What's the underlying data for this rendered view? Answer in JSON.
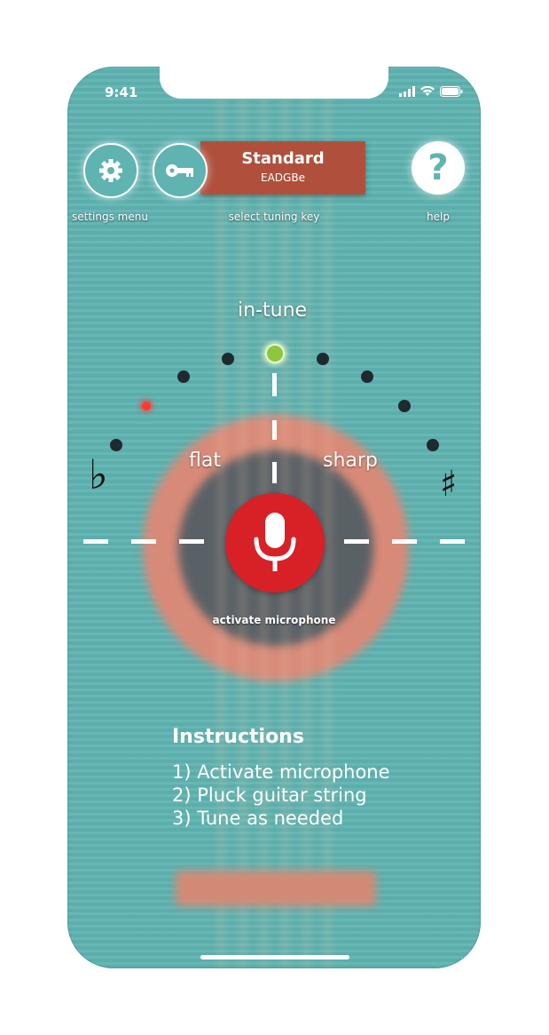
{
  "status_bar": {
    "time": "9:41"
  },
  "header": {
    "settings": {
      "label": "settings menu",
      "icon": "gear-icon"
    },
    "tuning": {
      "name": "Standard",
      "notes": "EADGBe",
      "label": "select tuning key",
      "icon": "key-icon"
    },
    "help": {
      "label": "help",
      "glyph": "?"
    }
  },
  "meter": {
    "in_tune_label": "in-tune",
    "flat_label": "flat",
    "sharp_label": "sharp",
    "flat_symbol": "♭",
    "sharp_symbol": "♯",
    "active_indicator": "in-tune"
  },
  "microphone": {
    "label": "activate microphone",
    "icon": "microphone-icon"
  },
  "instructions": {
    "title": "Instructions",
    "steps": [
      "1) Activate microphone",
      "2) Pluck guitar string",
      "3) Tune as needed"
    ]
  },
  "colors": {
    "background": "#5fb3b1",
    "tuning_box": "#b0503c",
    "mic_button": "#d82027",
    "in_tune_dot": "#8dc63f",
    "flat_dot": "#ff3b30"
  }
}
